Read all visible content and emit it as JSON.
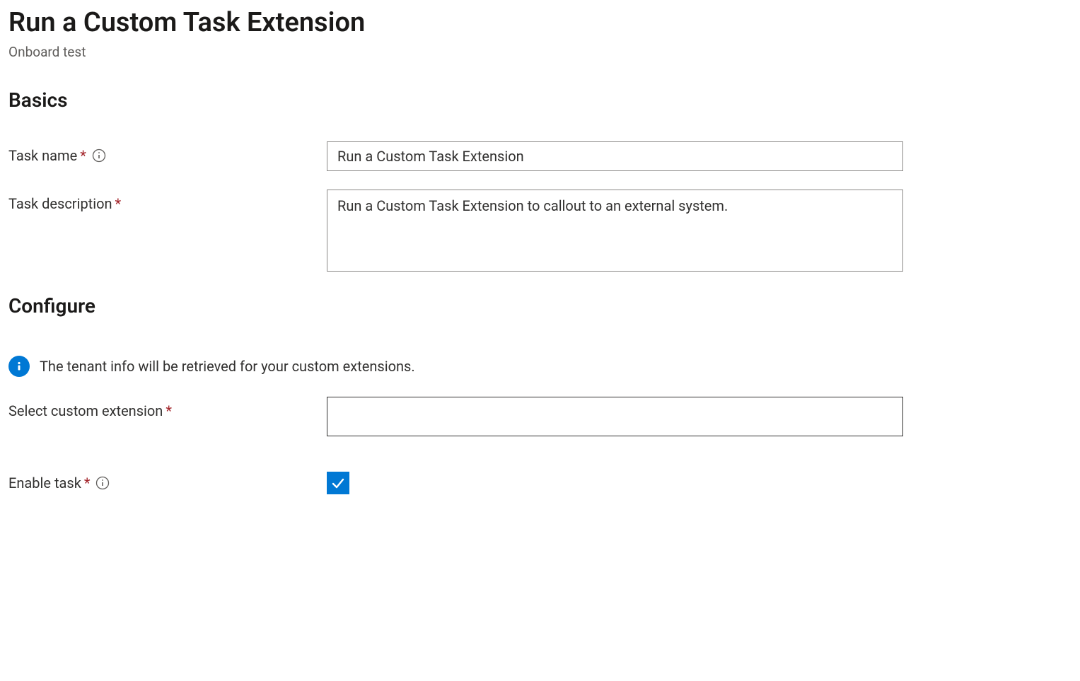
{
  "page": {
    "title": "Run a Custom Task Extension",
    "subtitle": "Onboard test"
  },
  "sections": {
    "basics": {
      "heading": "Basics",
      "taskName": {
        "label": "Task name",
        "value": "Run a Custom Task Extension"
      },
      "taskDescription": {
        "label": "Task description",
        "value": "Run a Custom Task Extension to callout to an external system."
      }
    },
    "configure": {
      "heading": "Configure",
      "infoMessage": "The tenant info will be retrieved for your custom extensions.",
      "selectExtension": {
        "label": "Select custom extension",
        "value": ""
      },
      "enableTask": {
        "label": "Enable task",
        "checked": true
      }
    }
  }
}
